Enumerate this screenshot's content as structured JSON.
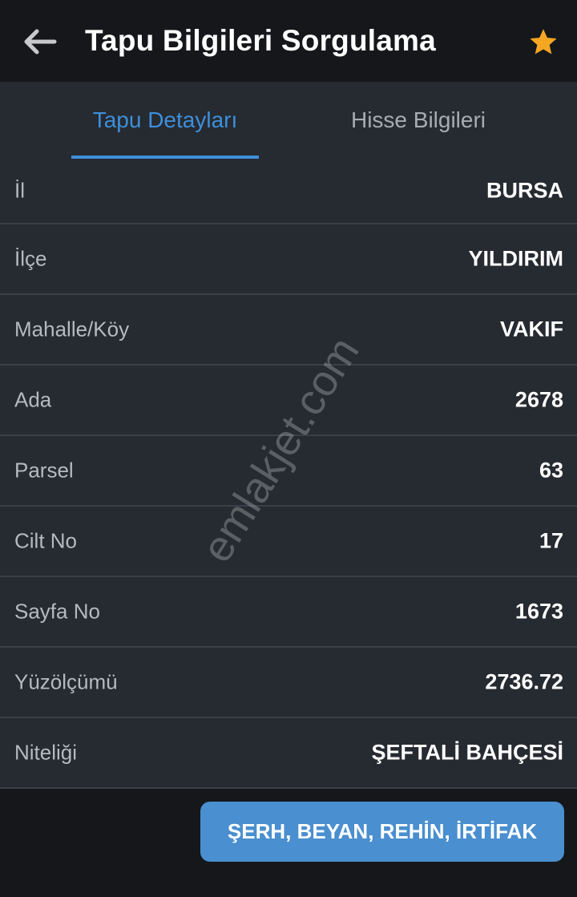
{
  "colors": {
    "appbar_bg": "#15171b",
    "content_bg": "#262a31",
    "accent": "#3e8fd9",
    "star": "#f5a623",
    "button": "#4a8fcf"
  },
  "appbar": {
    "back_icon": "arrow-left-icon",
    "title": "Tapu Bilgileri Sorgulama",
    "star_icon": "star-icon"
  },
  "tabs": [
    {
      "label": "Tapu Detayları",
      "active": true
    },
    {
      "label": "Hisse Bilgileri",
      "active": false
    }
  ],
  "details": [
    {
      "label": "İl",
      "value": "BURSA"
    },
    {
      "label": "İlçe",
      "value": "YILDIRIM"
    },
    {
      "label": "Mahalle/Köy",
      "value": "VAKIF"
    },
    {
      "label": "Ada",
      "value": "2678"
    },
    {
      "label": "Parsel",
      "value": "63"
    },
    {
      "label": "Cilt No",
      "value": "17"
    },
    {
      "label": "Sayfa No",
      "value": "1673"
    },
    {
      "label": "Yüzölçümü",
      "value": "2736.72"
    },
    {
      "label": "Niteliği",
      "value": "ŞEFTALİ BAHÇESİ"
    }
  ],
  "watermark": "emlakjet.com",
  "action_button": "ŞERH, BEYAN, REHİN, İRTİFAK"
}
